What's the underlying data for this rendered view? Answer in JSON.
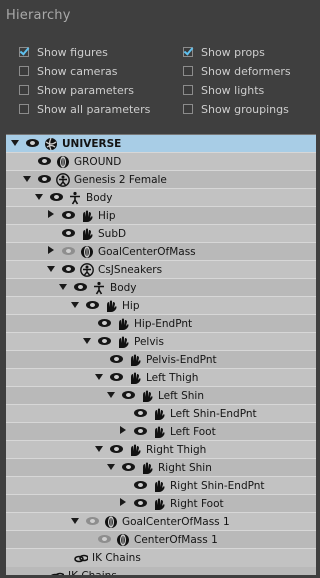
{
  "panel": {
    "title": "Hierarchy"
  },
  "options": [
    {
      "label": "Show figures",
      "checked": true
    },
    {
      "label": "Show props",
      "checked": true
    },
    {
      "label": "Show cameras",
      "checked": false
    },
    {
      "label": "Show deformers",
      "checked": false
    },
    {
      "label": "Show parameters",
      "checked": false
    },
    {
      "label": "Show lights",
      "checked": false
    },
    {
      "label": "Show all parameters",
      "checked": false
    },
    {
      "label": "Show groupings",
      "checked": false
    }
  ],
  "tree": [
    {
      "label": "UNIVERSE",
      "depth": 0,
      "arrow": "expanded",
      "eye": "on",
      "icon": "globe-icon",
      "selected": true
    },
    {
      "label": "GROUND",
      "depth": 1,
      "arrow": "none",
      "eye": "on",
      "icon": "prop-icon"
    },
    {
      "label": "Genesis 2 Female",
      "depth": 1,
      "arrow": "expanded",
      "eye": "on",
      "icon": "figure-icon"
    },
    {
      "label": "Body",
      "depth": 2,
      "arrow": "expanded",
      "eye": "on",
      "icon": "body-icon"
    },
    {
      "label": "Hip",
      "depth": 3,
      "arrow": "collapsed",
      "eye": "on",
      "icon": "bone-icon"
    },
    {
      "label": "SubD",
      "depth": 3,
      "arrow": "none",
      "eye": "on",
      "icon": "bone-icon"
    },
    {
      "label": "GoalCenterOfMass",
      "depth": 3,
      "arrow": "collapsed",
      "eye": "dim",
      "icon": "prop-icon"
    },
    {
      "label": "CsJSneakers",
      "depth": 3,
      "arrow": "expanded",
      "eye": "on",
      "icon": "figure-icon"
    },
    {
      "label": "Body",
      "depth": 4,
      "arrow": "expanded",
      "eye": "on",
      "icon": "body-icon"
    },
    {
      "label": "Hip",
      "depth": 5,
      "arrow": "expanded",
      "eye": "on",
      "icon": "bone-icon"
    },
    {
      "label": "Hip-EndPnt",
      "depth": 6,
      "arrow": "none",
      "eye": "on",
      "icon": "bone-icon"
    },
    {
      "label": "Pelvis",
      "depth": 6,
      "arrow": "expanded",
      "eye": "on",
      "icon": "bone-icon"
    },
    {
      "label": "Pelvis-EndPnt",
      "depth": 7,
      "arrow": "none",
      "eye": "on",
      "icon": "bone-icon"
    },
    {
      "label": "Left Thigh",
      "depth": 7,
      "arrow": "expanded",
      "eye": "on",
      "icon": "bone-icon"
    },
    {
      "label": "Left Shin",
      "depth": 8,
      "arrow": "expanded",
      "eye": "on",
      "icon": "bone-icon"
    },
    {
      "label": "Left Shin-EndPnt",
      "depth": 9,
      "arrow": "none",
      "eye": "on",
      "icon": "bone-icon"
    },
    {
      "label": "Left Foot",
      "depth": 9,
      "arrow": "collapsed",
      "eye": "on",
      "icon": "bone-icon"
    },
    {
      "label": "Right Thigh",
      "depth": 7,
      "arrow": "expanded",
      "eye": "on",
      "icon": "bone-icon"
    },
    {
      "label": "Right Shin",
      "depth": 8,
      "arrow": "expanded",
      "eye": "on",
      "icon": "bone-icon"
    },
    {
      "label": "Right Shin-EndPnt",
      "depth": 9,
      "arrow": "none",
      "eye": "on",
      "icon": "bone-icon"
    },
    {
      "label": "Right Foot",
      "depth": 9,
      "arrow": "collapsed",
      "eye": "on",
      "icon": "bone-icon"
    },
    {
      "label": "GoalCenterOfMass 1",
      "depth": 5,
      "arrow": "expanded",
      "eye": "dim",
      "icon": "prop-icon"
    },
    {
      "label": "CenterOfMass 1",
      "depth": 6,
      "arrow": "none",
      "eye": "dim",
      "icon": "prop-icon"
    },
    {
      "label": "IK Chains",
      "depth": 4,
      "arrow": "none",
      "eye": "none",
      "icon": "ik-chain-icon",
      "plain": true
    },
    {
      "label": "IK Chains",
      "depth": 2,
      "arrow": "none",
      "eye": "none",
      "icon": "ik-chain-icon",
      "plain": true
    }
  ]
}
